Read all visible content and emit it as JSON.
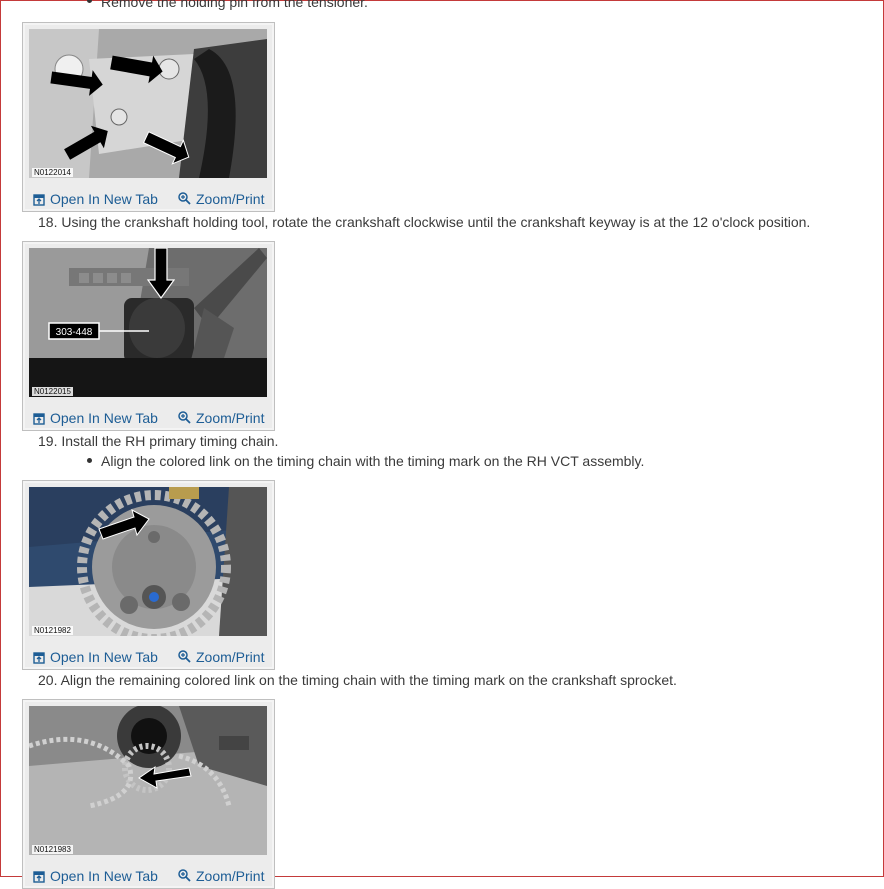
{
  "steps": {
    "top_bullet": "Remove the holding pin from the tensioner.",
    "s18": {
      "num": "18.",
      "text": "Using the crankshaft holding tool, rotate the crankshaft clockwise until the crankshaft keyway is at the 12 o'clock position."
    },
    "s19": {
      "num": "19.",
      "text": "Install the RH primary timing chain.",
      "bullet": "Align the colored link on the timing chain with the timing mark on the RH VCT assembly."
    },
    "s20": {
      "num": "20.",
      "text": "Align the remaining colored link on the timing chain with the timing mark on the crankshaft sprocket."
    }
  },
  "figures": [
    {
      "code": "N0122014",
      "open_label": "Open In New Tab",
      "zoom_label": "Zoom/Print"
    },
    {
      "code": "N0122015",
      "callout": "303-448",
      "open_label": "Open In New Tab",
      "zoom_label": "Zoom/Print"
    },
    {
      "code": "N0121982",
      "open_label": "Open In New Tab",
      "zoom_label": "Zoom/Print"
    },
    {
      "code": "N0121983",
      "open_label": "Open In New Tab",
      "zoom_label": "Zoom/Print"
    }
  ],
  "colors": {
    "link": "#1d5d95",
    "text": "#333333",
    "frame_border": "#c43a3a",
    "figure_border": "#bfbfbf"
  },
  "icons": {
    "open": "open-new-tab-icon",
    "zoom": "zoom-magnifier-icon"
  }
}
